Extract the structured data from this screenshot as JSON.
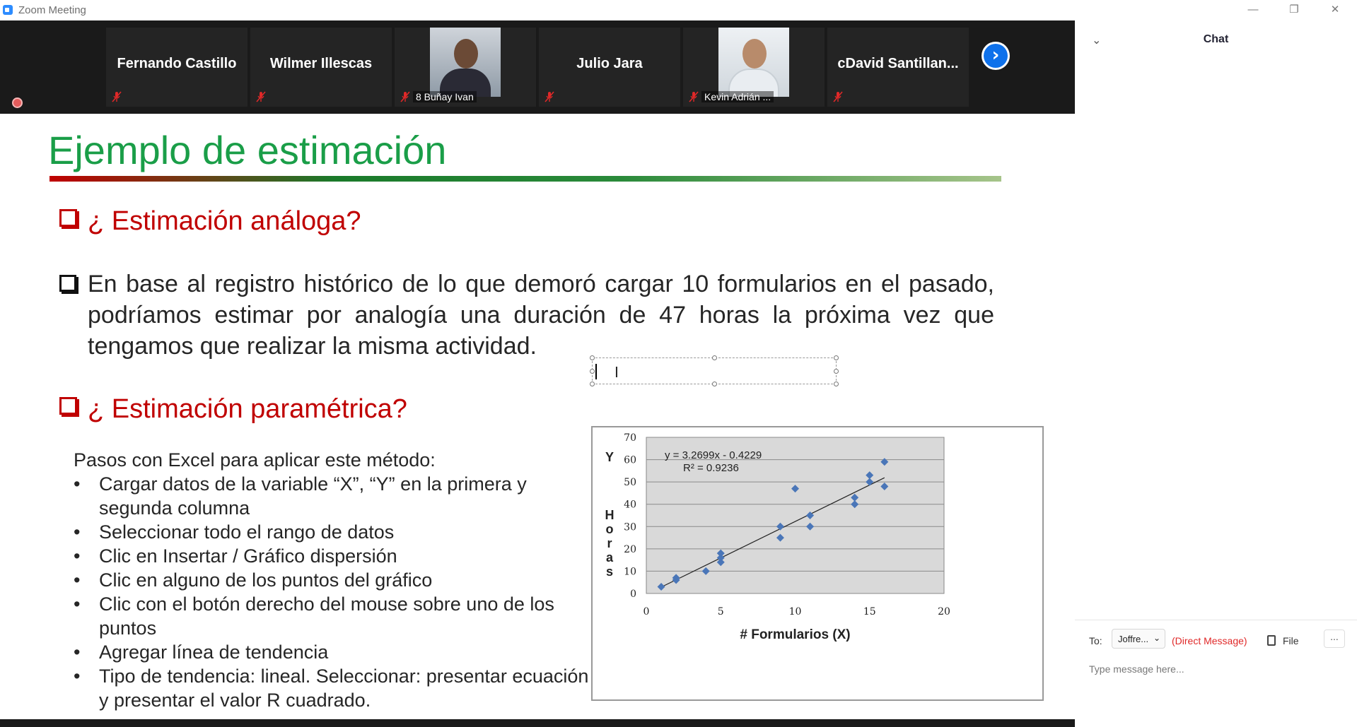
{
  "window": {
    "title": "Zoom Meeting",
    "minimize": "—",
    "restore": "❐",
    "close": "✕"
  },
  "gallery": {
    "participants": [
      {
        "name": "Fernando Castillo",
        "label": "",
        "video": false,
        "muted": true
      },
      {
        "name": "Wilmer Illescas",
        "label": "",
        "video": false,
        "muted": true
      },
      {
        "name": "",
        "label": "8 Buñay Ivan",
        "video": true,
        "muted": true
      },
      {
        "name": "Julio Jara",
        "label": "",
        "video": false,
        "muted": true
      },
      {
        "name": "",
        "label": "Kevin Adrián ...",
        "video": true,
        "muted": true
      },
      {
        "name": "cDavid  Santillan...",
        "label": "",
        "video": false,
        "muted": true
      }
    ],
    "next_icon": "›"
  },
  "slide": {
    "title": "Ejemplo de estimación",
    "bullet1": "¿ Estimación análoga?",
    "paragraph": "En base al registro histórico de lo que demoró cargar 10 formularios en el pasado, podríamos estimar por analogía una duración de 47 horas la próxima vez que tengamos que realizar la misma actividad.",
    "bullet2": "¿ Estimación paramétrica?",
    "steps_intro": "Pasos con Excel para aplicar este método:",
    "steps": [
      "Cargar datos de la variable “X”, “Y” en la primera y segunda columna",
      "Seleccionar todo el rango de datos",
      "Clic en Insertar / Gráfico dispersión",
      "Clic en alguno de los puntos del gráfico",
      "Clic con el botón derecho del mouse sobre uno de los puntos",
      "Agregar línea de tendencia",
      "Tipo de tendencia: lineal. Seleccionar: presentar ecuación y presentar el valor R cuadrado."
    ],
    "accent_red": "#c00000",
    "title_green": "#1a9e48"
  },
  "chart_data": {
    "type": "scatter",
    "title": "",
    "xlabel": "# Formularios (X)",
    "ylabel_top": "Y",
    "ylabel": "Horas",
    "xlim": [
      0,
      20
    ],
    "ylim": [
      0,
      70
    ],
    "xticks": [
      0,
      5,
      10,
      15,
      20
    ],
    "yticks": [
      0,
      10,
      20,
      30,
      40,
      50,
      60,
      70
    ],
    "grid": "horizontal",
    "points": [
      {
        "x": 1,
        "y": 3
      },
      {
        "x": 2,
        "y": 6
      },
      {
        "x": 2,
        "y": 7
      },
      {
        "x": 4,
        "y": 10
      },
      {
        "x": 5,
        "y": 14
      },
      {
        "x": 5,
        "y": 16
      },
      {
        "x": 5,
        "y": 18
      },
      {
        "x": 9,
        "y": 25
      },
      {
        "x": 9,
        "y": 30
      },
      {
        "x": 10,
        "y": 47
      },
      {
        "x": 11,
        "y": 30
      },
      {
        "x": 11,
        "y": 35
      },
      {
        "x": 14,
        "y": 40
      },
      {
        "x": 14,
        "y": 43
      },
      {
        "x": 15,
        "y": 50
      },
      {
        "x": 15,
        "y": 53
      },
      {
        "x": 16,
        "y": 48
      },
      {
        "x": 16,
        "y": 59
      }
    ],
    "trendline": {
      "slope": 3.2699,
      "intercept": -0.4229,
      "x_range": [
        1,
        16
      ]
    },
    "equation": "y = 3.2699x - 0.4229",
    "r_squared": "R² = 0.9236",
    "point_color": "#4a76b8",
    "plot_bg": "#d9d9d9"
  },
  "chat": {
    "collapse_icon": "⌄",
    "title": "Chat",
    "to_label": "To:",
    "recipient": "Joffre...",
    "recipient_chevron": "⌄",
    "direct_message": "(Direct Message)",
    "file_label": "File",
    "more_label": "...",
    "input_placeholder": "Type message here..."
  }
}
